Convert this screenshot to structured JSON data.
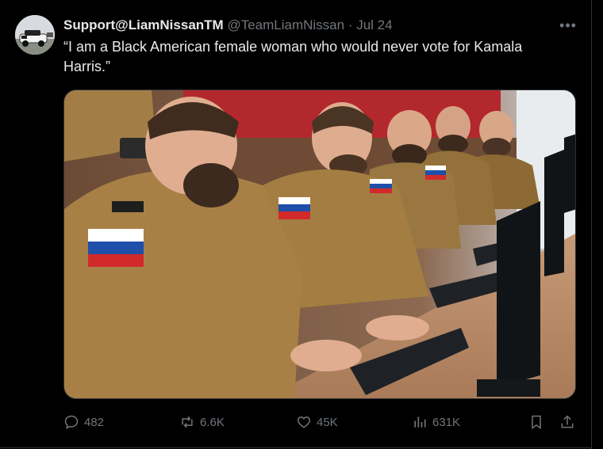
{
  "tweet": {
    "display_name": "Support@LiamNissanTM",
    "handle": "@TeamLiamNissan",
    "separator": "·",
    "date": "Jul 24",
    "more_icon": "ellipsis-icon",
    "text": "“I am a Black American female woman who would never vote for Kamala Harris.”"
  },
  "actions": {
    "replies": "482",
    "reposts": "6.6K",
    "likes": "45K",
    "views": "631K"
  },
  "colors": {
    "background": "#000000",
    "text": "#e7e9ea",
    "muted": "#71767b",
    "border": "#2f3336"
  }
}
